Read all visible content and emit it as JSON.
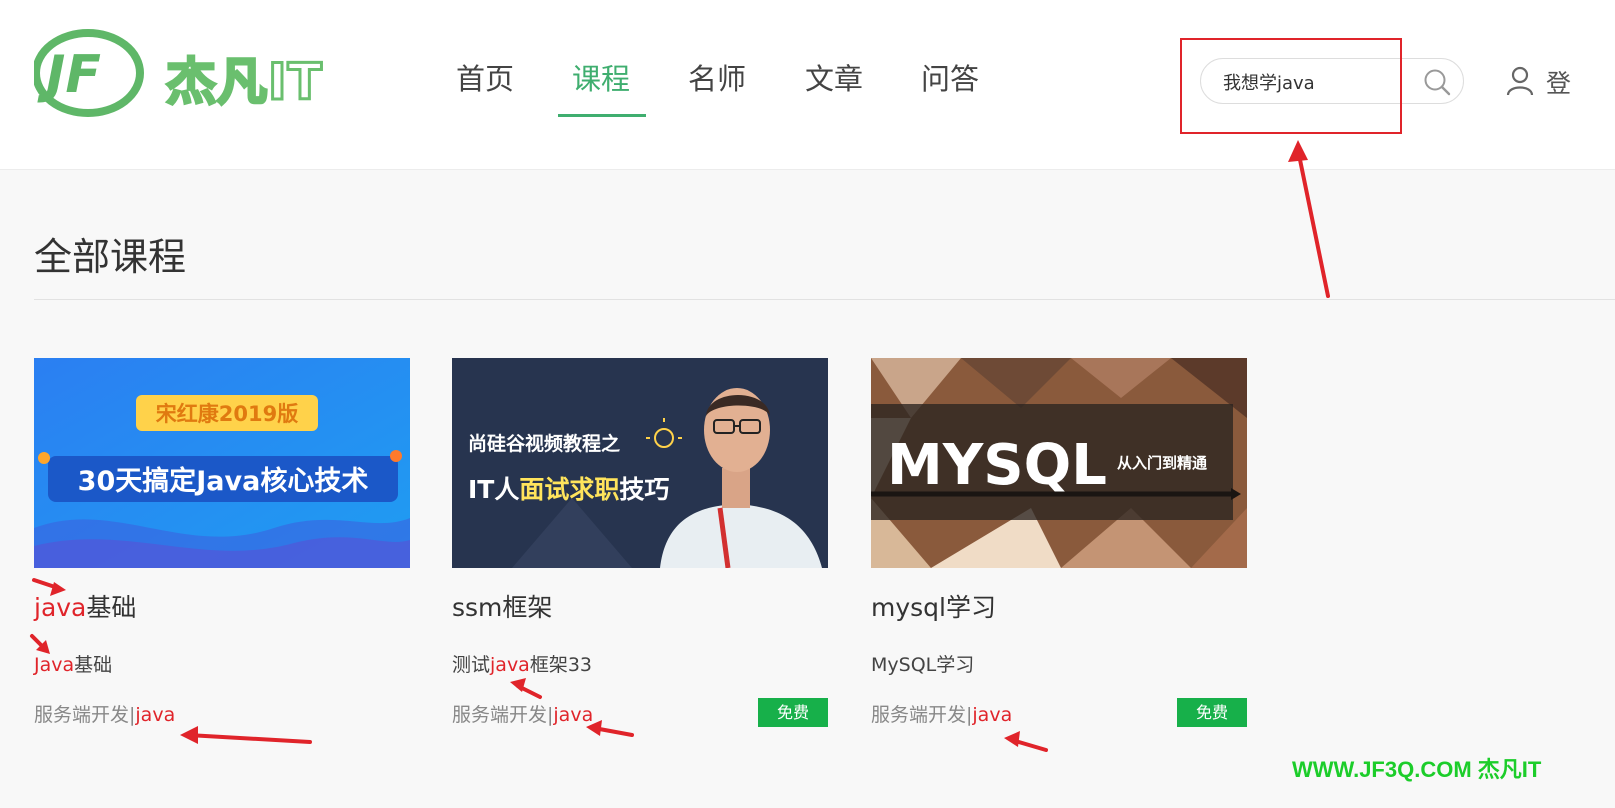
{
  "header": {
    "logo_text": "杰凡IT",
    "nav": [
      {
        "label": "首页",
        "active": false
      },
      {
        "label": "课程",
        "active": true
      },
      {
        "label": "名师",
        "active": false
      },
      {
        "label": "文章",
        "active": false
      },
      {
        "label": "问答",
        "active": false
      }
    ],
    "search_value": "我想学java",
    "login_label": "登"
  },
  "page_title": "全部课程",
  "courses": [
    {
      "title_hl": "java",
      "title_rest": "基础",
      "desc_pre": "",
      "desc_hl": "Java",
      "desc_rest": "基础",
      "cat_pre": "服务端开发|",
      "cat_hl": "java",
      "badge": "",
      "cover": {
        "badge": "宋红康2019版",
        "headline": "30天搞定Java核心技术"
      }
    },
    {
      "title_hl": "",
      "title_rest": "ssm框架",
      "desc_pre": "测试",
      "desc_hl": "java",
      "desc_rest": "框架33",
      "cat_pre": "服务端开发|",
      "cat_hl": "java",
      "badge": "免费",
      "cover": {
        "line1": "尚硅谷视频教程之",
        "line2_a": "IT人",
        "line2_b": "面试求职",
        "line2_c": "技巧"
      }
    },
    {
      "title_hl": "",
      "title_rest": "mysql学习",
      "desc_pre": "MySQL学习",
      "desc_hl": "",
      "desc_rest": "",
      "cat_pre": "服务端开发|",
      "cat_hl": "java",
      "badge": "免费",
      "cover": {
        "headline": "MYSQL",
        "sub": "从入门到精通"
      }
    }
  ],
  "watermark": "WWW.JF3Q.COM 杰凡IT",
  "colors": {
    "accent": "#3fae6f",
    "highlight": "#e0242a",
    "badge": "#17b04a",
    "annotation": "#e0242a"
  }
}
